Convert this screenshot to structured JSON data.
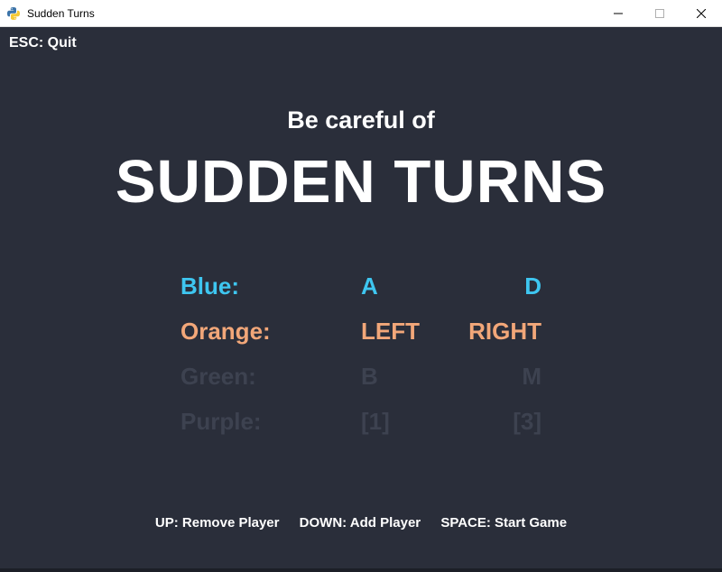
{
  "window": {
    "title": "Sudden Turns",
    "icon": "python-icon"
  },
  "game": {
    "esc_hint": "ESC: Quit",
    "subtitle": "Be careful of",
    "title": "SUDDEN TURNS",
    "players": [
      {
        "name": "Blue:",
        "left": "A",
        "right": "D",
        "color": "#3ec6f0",
        "active": true
      },
      {
        "name": "Orange:",
        "left": "LEFT",
        "right": "RIGHT",
        "color": "#f2a779",
        "active": true
      },
      {
        "name": "Green:",
        "left": "B",
        "right": "M",
        "color": "#3d4250",
        "active": false
      },
      {
        "name": "Purple:",
        "left": "[1]",
        "right": "[3]",
        "color": "#3d4250",
        "active": false
      }
    ],
    "footer": {
      "remove": "UP: Remove Player",
      "add": "DOWN: Add Player",
      "start": "SPACE: Start Game"
    }
  },
  "colors": {
    "background": "#2a2e3a",
    "text": "#ffffff"
  }
}
